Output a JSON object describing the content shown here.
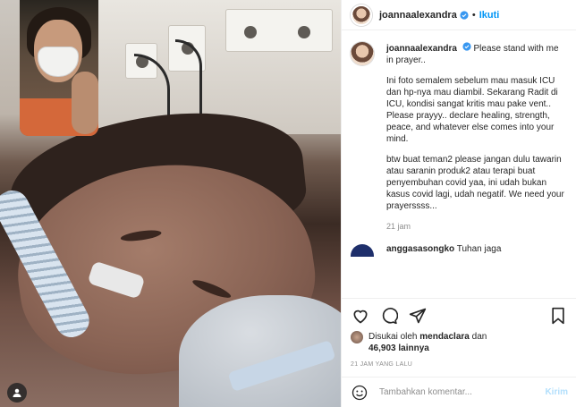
{
  "post": {
    "author": "joannaalexandra",
    "follow_label": "Ikuti",
    "separator": "•"
  },
  "caption": {
    "author": "joannaalexandra",
    "lead": "Please stand with me in prayer..",
    "para1": "Ini foto semalem sebelum mau masuk ICU dan hp-nya mau diambil. Sekarang Radit di ICU, kondisi sangat kritis mau pake vent.. Please prayyy.. declare healing, strength, peace, and whatever else comes into your mind.",
    "para2": "btw buat teman2 please jangan dulu tawarin atau saranin produk2 atau terapi buat penyembuhan covid yaa, ini udah bukan kasus covid lagi, udah negatif. We need your prayerssss...",
    "time": "21 jam"
  },
  "reply": {
    "author": "anggasasongko",
    "text": "Tuhan jaga"
  },
  "actions": {
    "like_icon": "heart-icon",
    "comment_icon": "comment-icon",
    "share_icon": "share-icon",
    "save_icon": "bookmark-icon"
  },
  "likes": {
    "prefix": "Disukai oleh",
    "user": "mendaclara",
    "joiner": "dan",
    "count": "46,903 lainnya"
  },
  "timestamp": "21 JAM YANG LALU",
  "add_comment": {
    "placeholder": "Tambahkan komentar...",
    "post_label": "Kirim"
  },
  "colors": {
    "accent": "#0095f6",
    "post_disabled": "#b2dffc",
    "muted": "#8e8e8e"
  }
}
